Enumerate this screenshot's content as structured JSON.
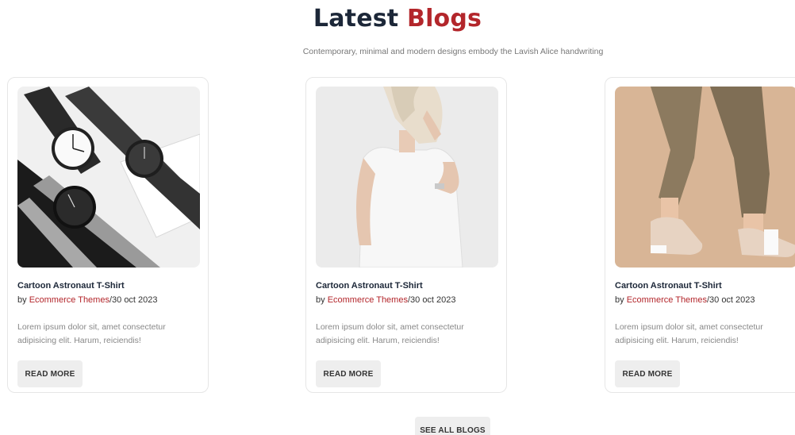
{
  "section": {
    "title_part1": "Latest",
    "title_part2": "Blogs",
    "subtitle": "Contemporary, minimal and modern designs embody the Lavish Alice handwriting"
  },
  "cards": [
    {
      "image": "watches-photo",
      "title": "Cartoon Astronaut T-Shirt",
      "by": "by ",
      "author": "Ecommerce Themes",
      "date": "/30 oct 2023",
      "excerpt": "Lorem ipsum dolor sit, amet consectetur adipisicing elit. Harum, reiciendis!",
      "button": "READ MORE"
    },
    {
      "image": "woman-white-top-photo",
      "title": "Cartoon Astronaut T-Shirt",
      "by": "by ",
      "author": "Ecommerce Themes",
      "date": "/30 oct 2023",
      "excerpt": "Lorem ipsum dolor sit, amet consectetur adipisicing elit. Harum, reiciendis!",
      "button": "READ MORE"
    },
    {
      "image": "sneakers-photo",
      "title": "Cartoon Astronaut T-Shirt",
      "by": "by ",
      "author": "Ecommerce Themes",
      "date": "/30 oct 2023",
      "excerpt": "Lorem ipsum dolor sit, amet consectetur adipisicing elit. Harum, reiciendis!",
      "button": "READ MORE"
    }
  ],
  "see_all": "SEE ALL BLOGS",
  "colors": {
    "heading": "#1c2738",
    "accent": "#b3262b",
    "button_bg": "#eeeeee"
  }
}
